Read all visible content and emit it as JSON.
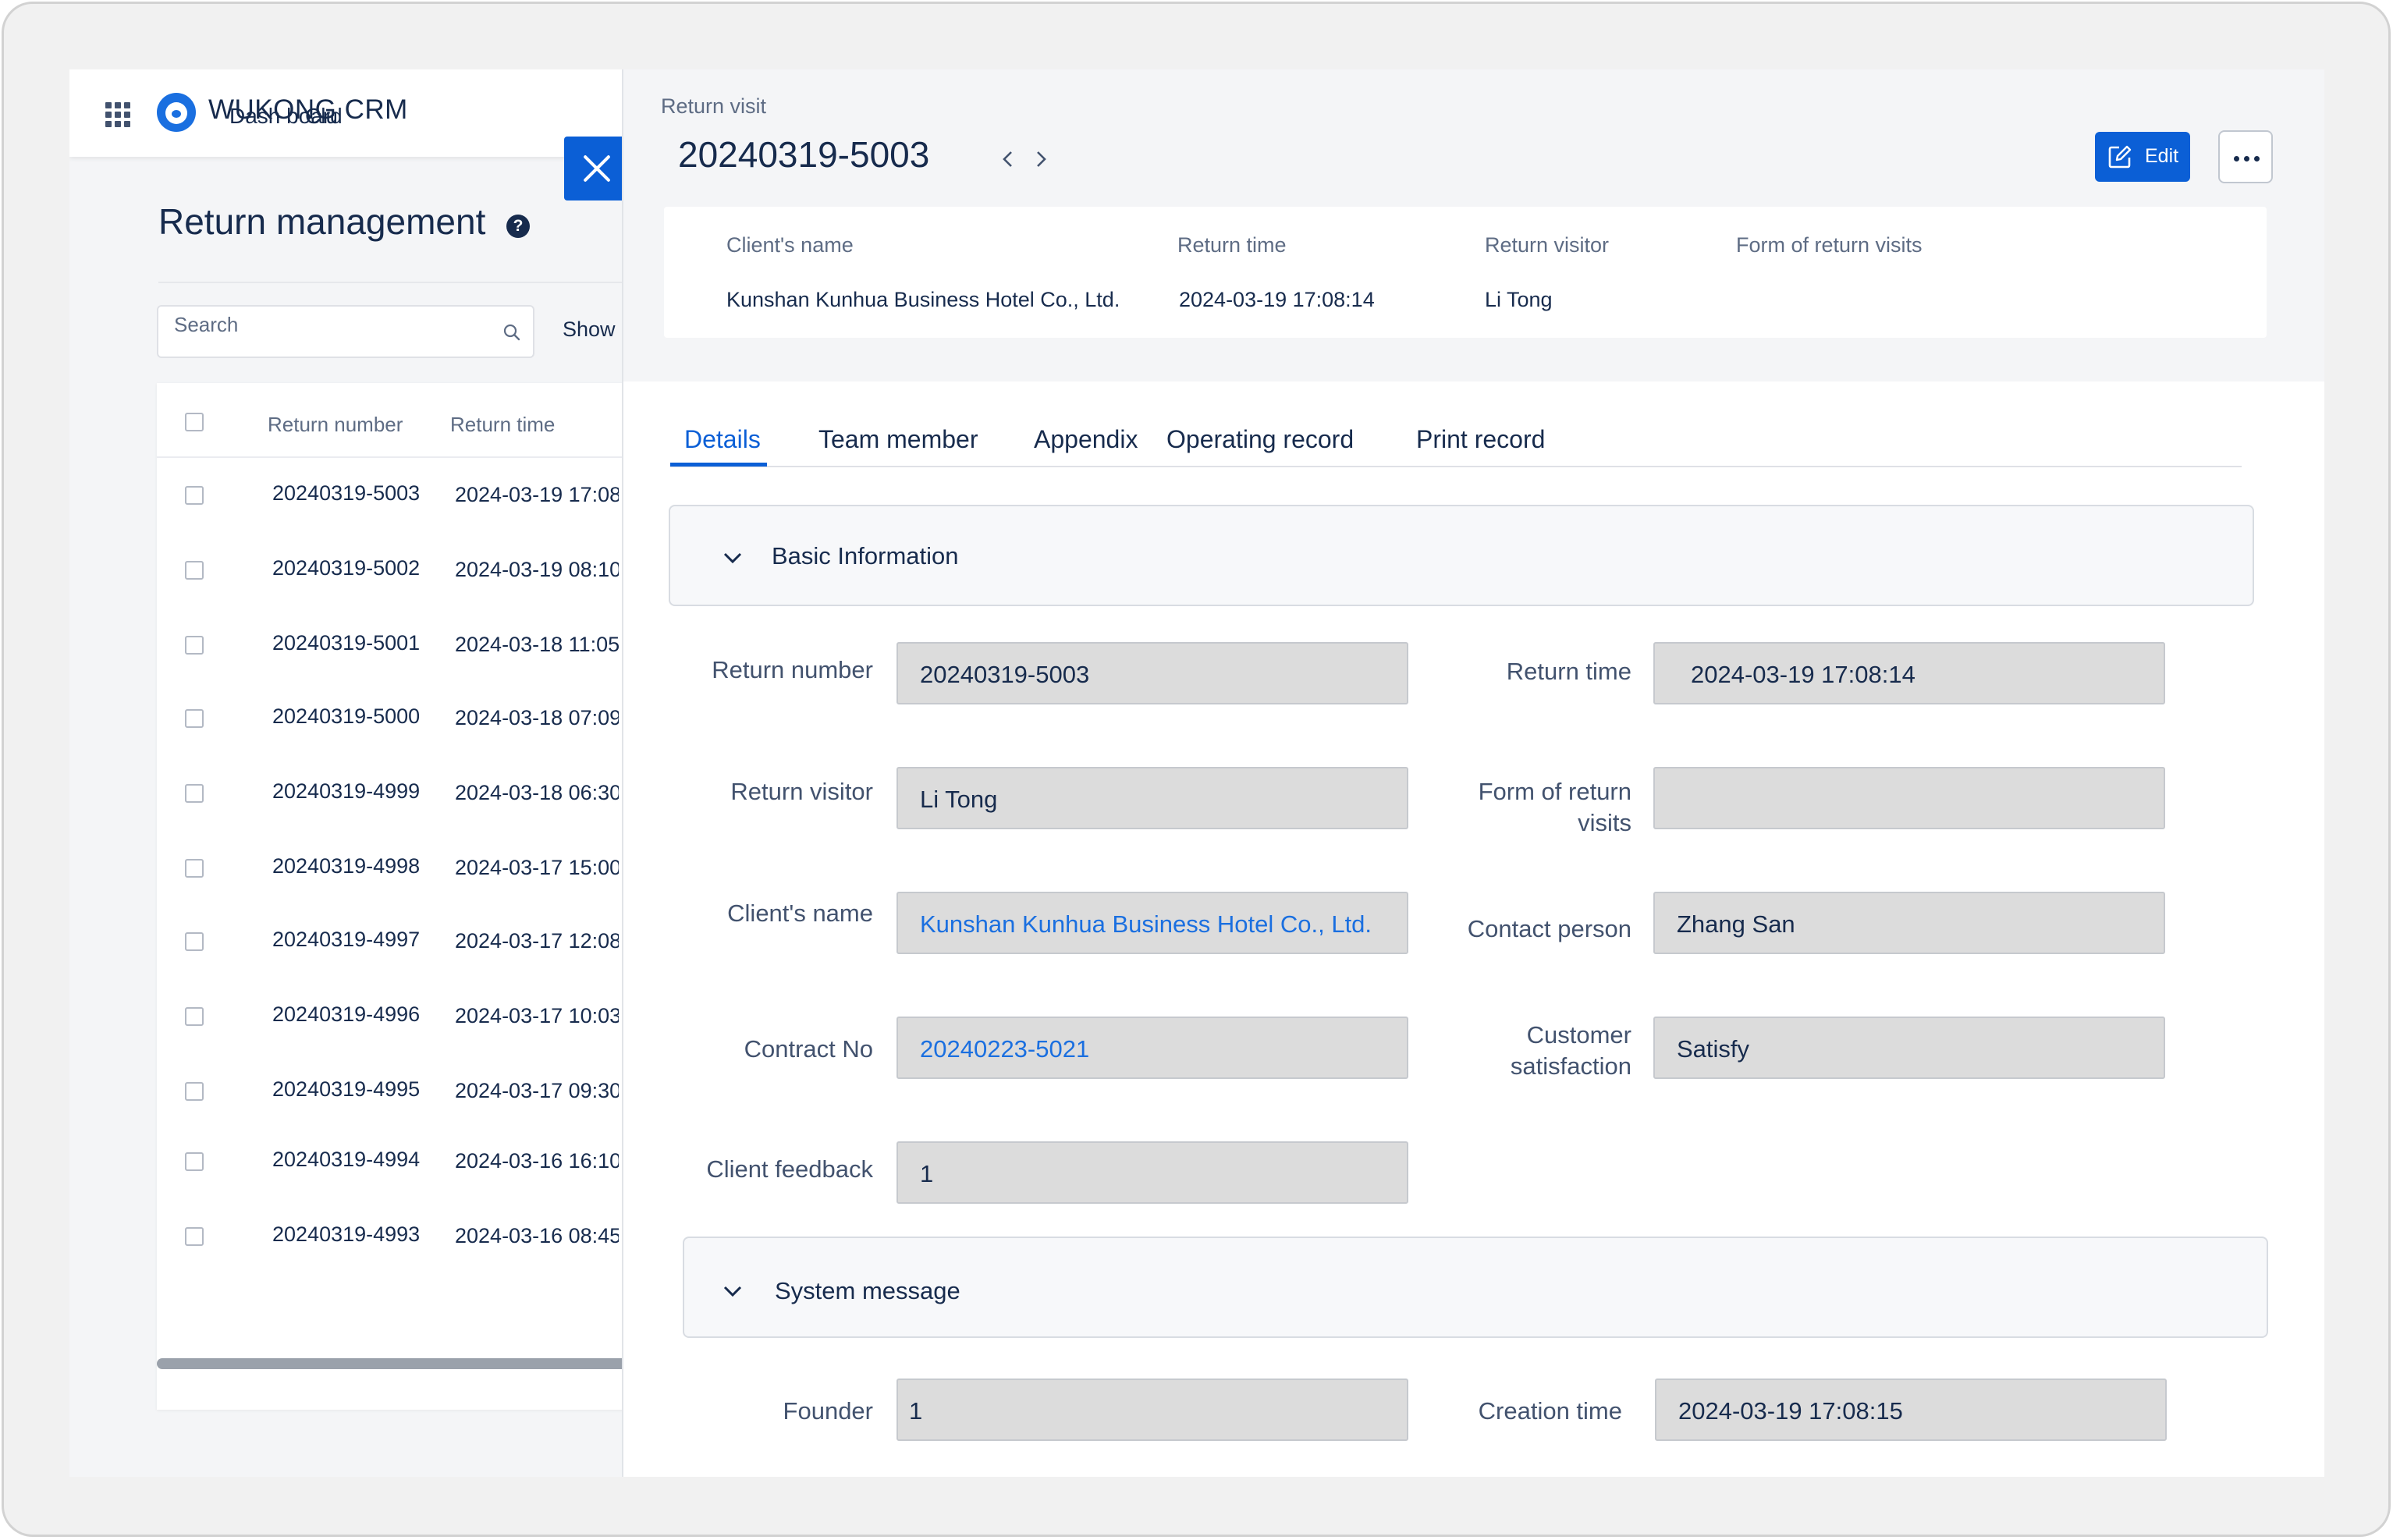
{
  "app": {
    "brand": "WUKONG CRM",
    "nav": [
      "Dash board",
      "Clu"
    ]
  },
  "list": {
    "title": "Return management",
    "search_placeholder": "Search",
    "show_label": "Show",
    "columns": [
      "Return number",
      "Return time"
    ],
    "rows": [
      {
        "number": "20240319-5003",
        "time": "2024-03-19 17:08"
      },
      {
        "number": "20240319-5002",
        "time": "2024-03-19 08:10"
      },
      {
        "number": "20240319-5001",
        "time": "2024-03-18 11:05"
      },
      {
        "number": "20240319-5000",
        "time": "2024-03-18 07:09"
      },
      {
        "number": "20240319-4999",
        "time": "2024-03-18 06:30"
      },
      {
        "number": "20240319-4998",
        "time": "2024-03-17 15:00"
      },
      {
        "number": "20240319-4997",
        "time": "2024-03-17 12:08"
      },
      {
        "number": "20240319-4996",
        "time": "2024-03-17 10:03"
      },
      {
        "number": "20240319-4995",
        "time": "2024-03-17 09:30"
      },
      {
        "number": "20240319-4994",
        "time": "2024-03-16 16:10"
      },
      {
        "number": "20240319-4993",
        "time": "2024-03-16 08:45"
      }
    ]
  },
  "detail": {
    "breadcrumb": "Return visit",
    "record_title": "20240319-5003",
    "edit_label": "Edit",
    "summary": {
      "labels": [
        "Client's name",
        "Return time",
        "Return visitor",
        "Form of return visits"
      ],
      "values": [
        "Kunshan Kunhua Business Hotel Co., Ltd.",
        "2024-03-19 17:08:14",
        "Li Tong",
        ""
      ]
    },
    "tabs": [
      "Details",
      "Team member",
      "Appendix",
      "Operating record",
      "Print record"
    ],
    "basic_section": "Basic Information",
    "system_section": "System message",
    "fields": {
      "return_number": {
        "label": "Return number",
        "value": "20240319-5003"
      },
      "return_time": {
        "label": "Return time",
        "value": "2024-03-19 17:08:14"
      },
      "return_visitor": {
        "label": "Return visitor",
        "value": "Li Tong"
      },
      "form_of_return_visits": {
        "label": "Form of return visits",
        "value": ""
      },
      "clients_name": {
        "label": "Client's name",
        "value": "Kunshan Kunhua Business Hotel Co., Ltd."
      },
      "contact_person": {
        "label": "Contact person",
        "value": "Zhang San"
      },
      "contract_no": {
        "label": "Contract No",
        "value": "20240223-5021"
      },
      "customer_satisfaction": {
        "label": "Customer satisfaction",
        "value": "Satisfy"
      },
      "client_feedback": {
        "label": "Client feedback",
        "value": "1"
      },
      "founder": {
        "label": "Founder",
        "value": "1"
      },
      "creation_time": {
        "label": "Creation time",
        "value": "2024-03-19 17:08:15"
      }
    }
  },
  "colors": {
    "accent": "#0b5fd6",
    "link": "#1a6fe0",
    "text": "#172b4d"
  }
}
